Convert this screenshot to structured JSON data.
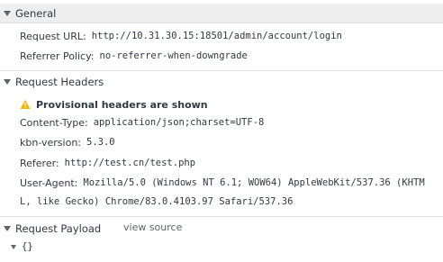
{
  "general": {
    "title": "General",
    "request_url_key": "Request URL:",
    "request_url_value": "http://10.31.30.15:18501/admin/account/login",
    "referrer_policy_key": "Referrer Policy:",
    "referrer_policy_value": "no-referrer-when-downgrade"
  },
  "request_headers": {
    "title": "Request Headers",
    "provisional_text": "Provisional headers are shown",
    "content_type_key": "Content-Type:",
    "content_type_value": "application/json;charset=UTF-8",
    "kbn_version_key": "kbn-version:",
    "kbn_version_value": "5.3.0",
    "referer_key": "Referer:",
    "referer_value": "http://test.cn/test.php",
    "user_agent_key": "User-Agent:",
    "user_agent_value_line1": "Mozilla/5.0 (Windows NT 6.1; WOW64) AppleWebKit/537.36 (KHTM",
    "user_agent_value_line2": "L, like Gecko) Chrome/83.0.4103.97 Safari/537.36"
  },
  "request_payload": {
    "title": "Request Payload",
    "view_source_label": "view source",
    "payload_value": "{}"
  },
  "colors": {
    "header_bg": "#eeeeee",
    "warning": "#f4b400"
  }
}
